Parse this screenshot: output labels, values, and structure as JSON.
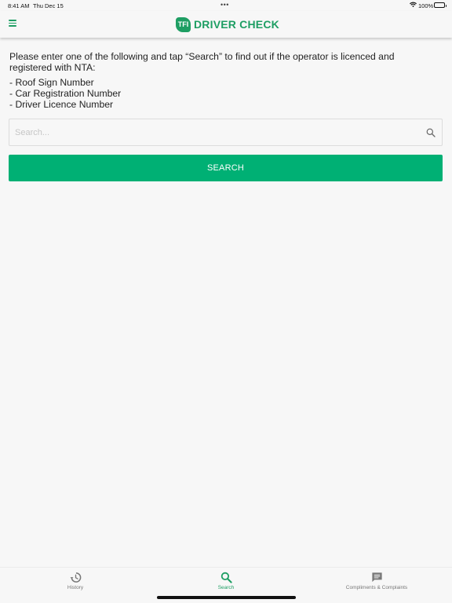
{
  "status_bar": {
    "time": "8:41 AM",
    "date": "Thu Dec 15",
    "battery": "100%"
  },
  "header": {
    "logo_text": "TFI",
    "title": "DRIVER CHECK",
    "brand_color": "#1e9e63"
  },
  "main": {
    "intro": "Please enter one of the following and tap “Search” to find out if the operator is licenced and registered with NTA:",
    "options": [
      "- Roof Sign Number",
      "- Car Registration Number",
      "- Driver Licence Number"
    ],
    "search": {
      "placeholder": "Search...",
      "value": ""
    },
    "search_button_label": "SEARCH",
    "accent_color": "#00b074"
  },
  "tabs": [
    {
      "label": "History",
      "icon": "history-icon",
      "active": false
    },
    {
      "label": "Search",
      "icon": "search-icon",
      "active": true
    },
    {
      "label": "Compliments & Complaints",
      "icon": "chat-icon",
      "active": false
    }
  ]
}
